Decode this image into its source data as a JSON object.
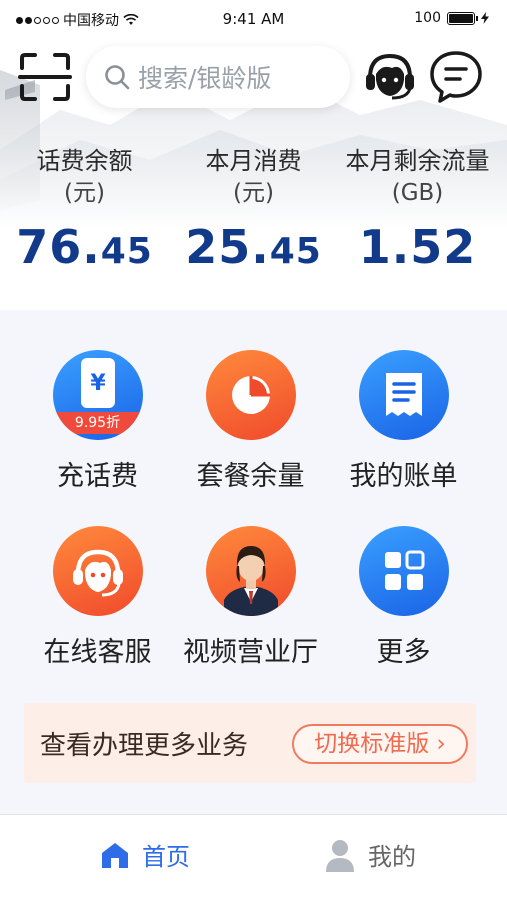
{
  "status_bar": {
    "carrier": "中国移动",
    "time": "9:41 AM",
    "battery": "100"
  },
  "header": {
    "search_placeholder": "搜索/银龄版",
    "icons": [
      "scan-icon",
      "customer-service-icon",
      "message-icon"
    ]
  },
  "stats": [
    {
      "label": "话费余额",
      "unit": "(元)",
      "value_int": "76.",
      "value_dec": "45"
    },
    {
      "label": "本月消费",
      "unit": "(元)",
      "value_int": "25.",
      "value_dec": "45"
    },
    {
      "label": "本月剩余流量",
      "unit": "(GB)",
      "value_int": "1.52",
      "value_dec": ""
    }
  ],
  "services": [
    {
      "label": "充话费",
      "icon": "recharge-icon",
      "badge": "9.95折"
    },
    {
      "label": "套餐余量",
      "icon": "pie-chart-icon"
    },
    {
      "label": "我的账单",
      "icon": "bill-icon"
    },
    {
      "label": "在线客服",
      "icon": "agent-icon"
    },
    {
      "label": "视频营业厅",
      "icon": "video-hall-avatar"
    },
    {
      "label": "更多",
      "icon": "more-grid-icon"
    }
  ],
  "banner": {
    "text": "查看办理更多业务",
    "button": "切换标准版"
  },
  "tabbar": {
    "home": "首页",
    "mine": "我的"
  },
  "colors": {
    "primary": "#2f6de8",
    "value_text": "#123a8a",
    "accent_orange": "#f04a2c"
  }
}
